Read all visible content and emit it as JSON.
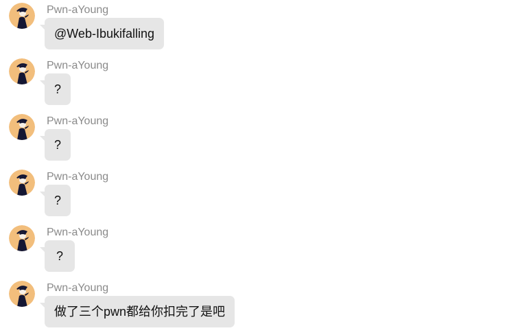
{
  "messages": [
    {
      "sender": "Pwn-aYoung",
      "avatar_icon": "user-avatar-icon",
      "text": "@Web-Ibukifalling"
    },
    {
      "sender": "Pwn-aYoung",
      "avatar_icon": "user-avatar-icon",
      "text": "?"
    },
    {
      "sender": "Pwn-aYoung",
      "avatar_icon": "user-avatar-icon",
      "text": "?"
    },
    {
      "sender": "Pwn-aYoung",
      "avatar_icon": "user-avatar-icon",
      "text": "?"
    },
    {
      "sender": "Pwn-aYoung",
      "avatar_icon": "user-avatar-icon",
      "text": "?"
    },
    {
      "sender": "Pwn-aYoung",
      "avatar_icon": "user-avatar-icon",
      "text": "做了三个pwn都给你扣完了是吧"
    }
  ],
  "colors": {
    "bubble": "#e6e6e6",
    "sender": "#8a8a8a",
    "avatar_bg": "#f2be7c",
    "avatar_figure": "#141633"
  }
}
